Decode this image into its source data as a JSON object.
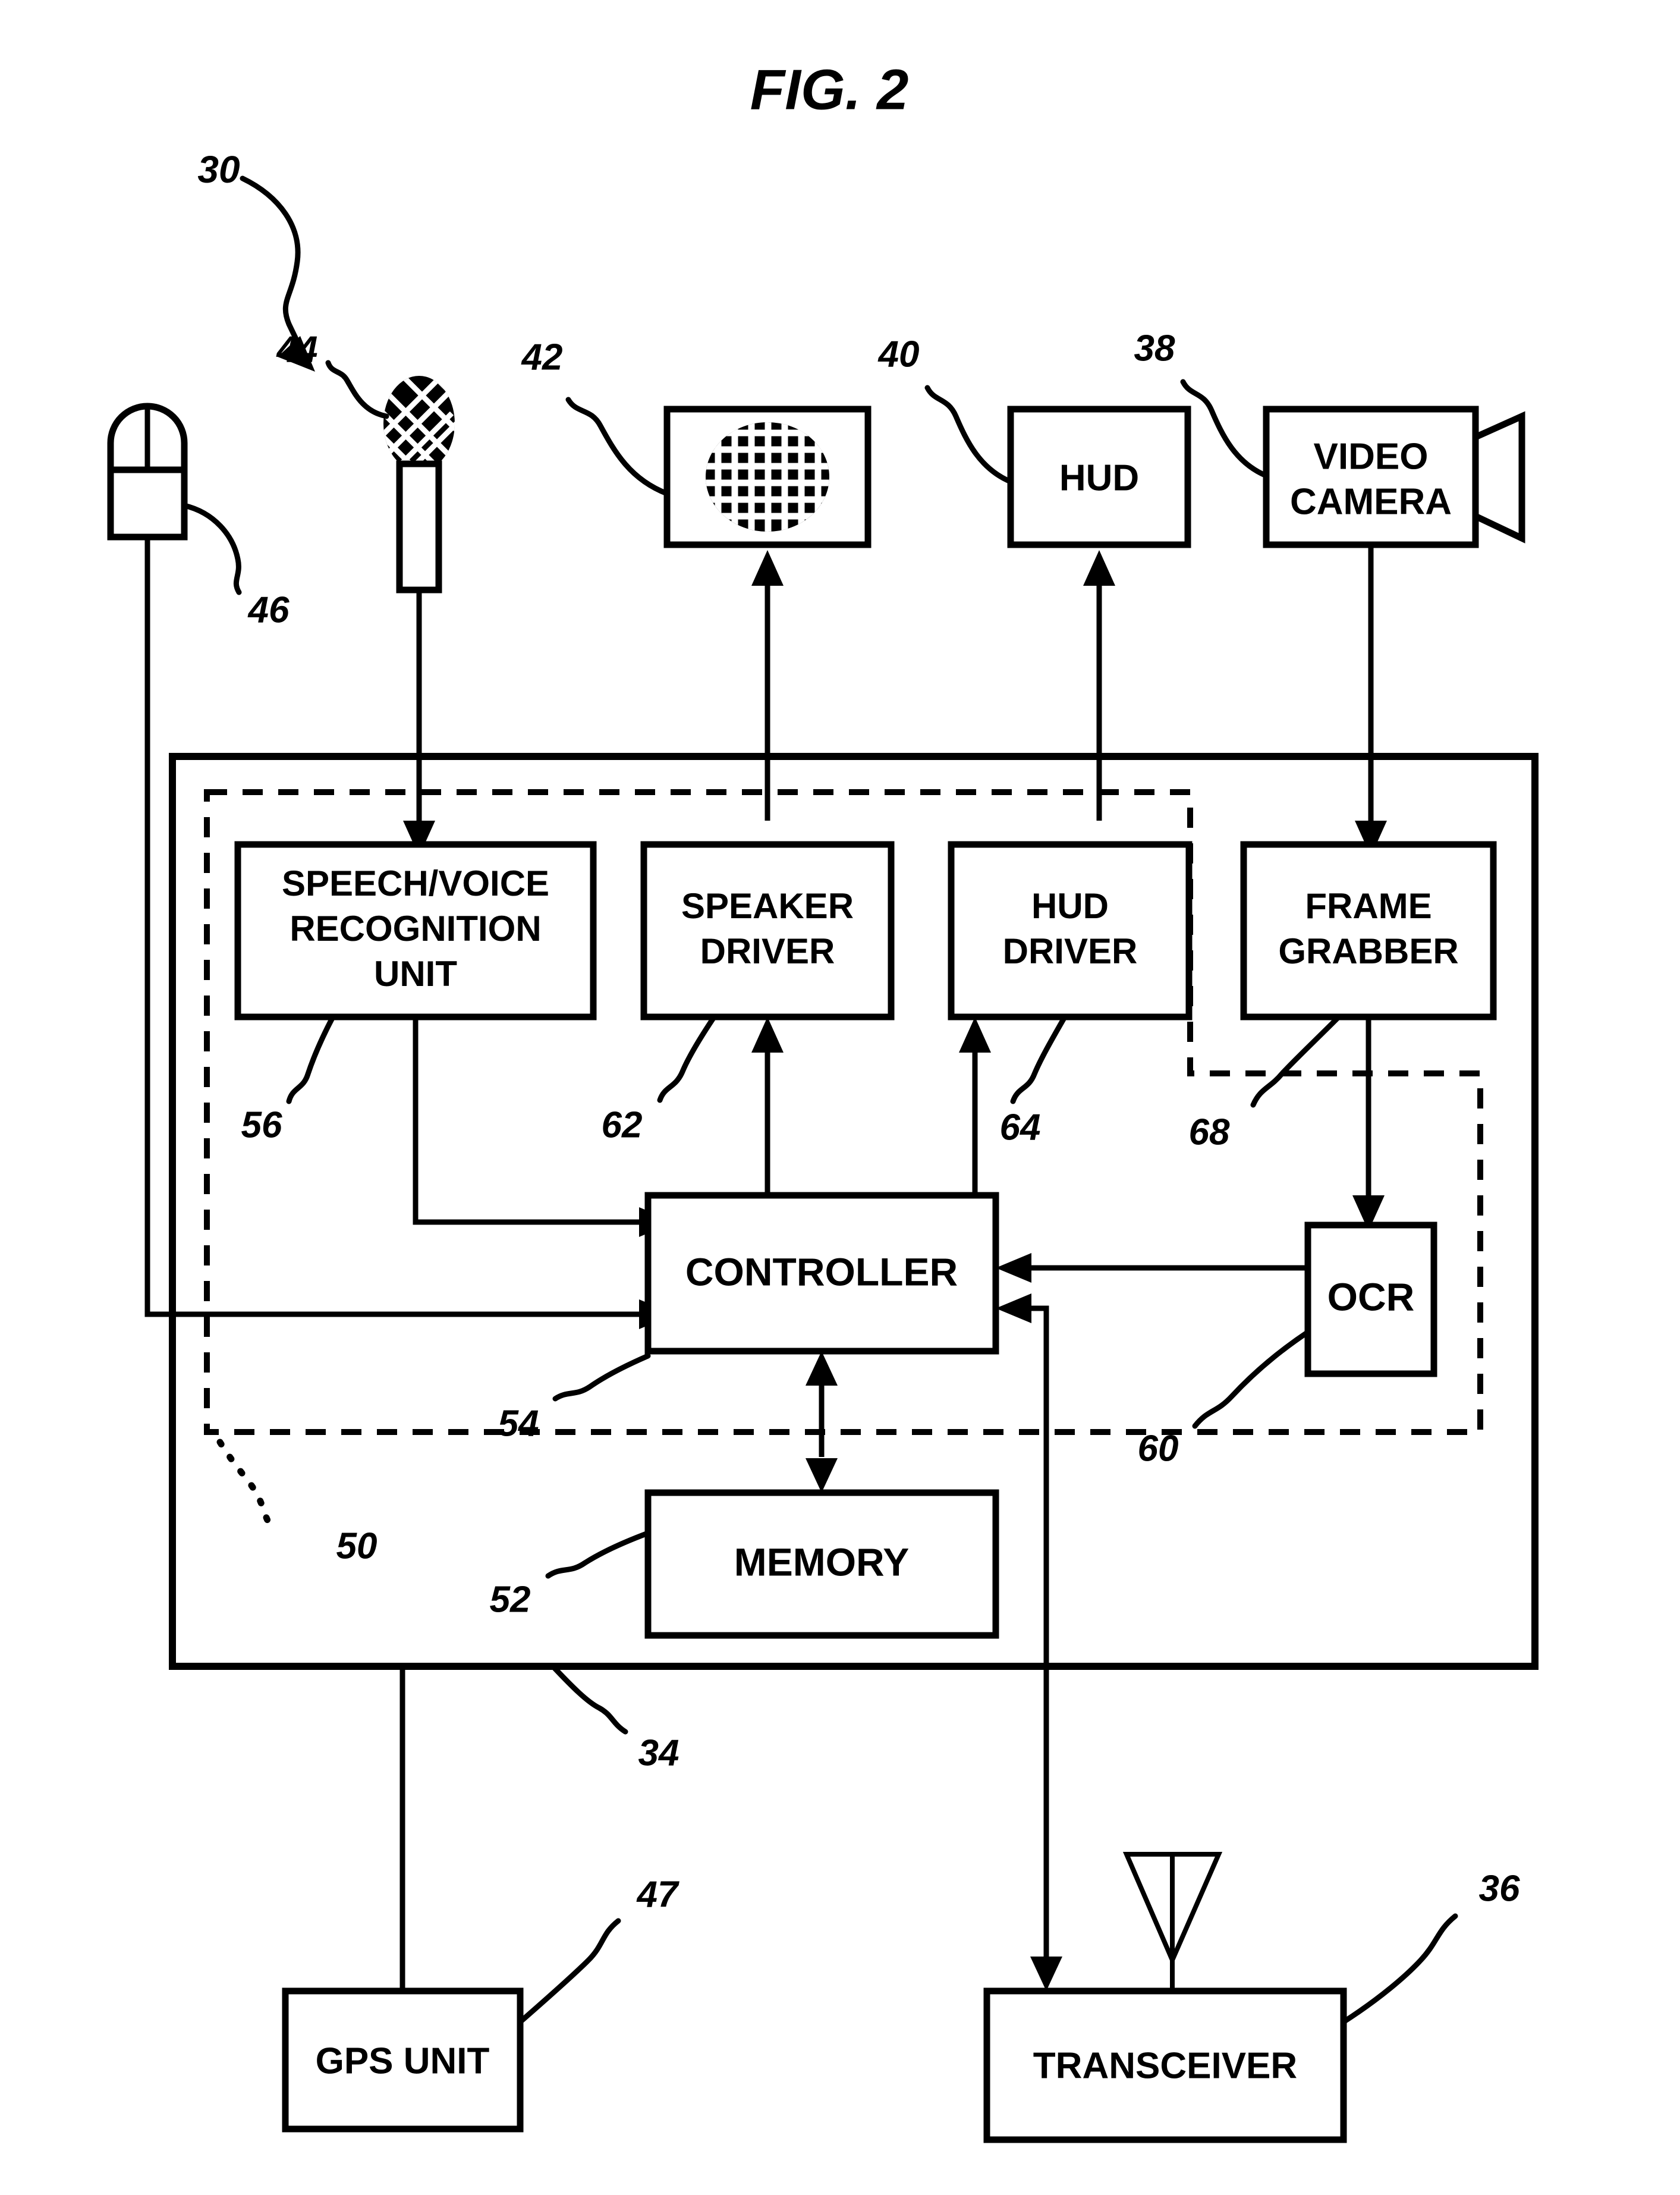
{
  "figure": {
    "title": "FIG. 2",
    "system_ref": "30"
  },
  "devices": [
    {
      "id": "mouse",
      "label": "",
      "ref": "46",
      "icon": "mouse-icon"
    },
    {
      "id": "microphone",
      "label": "",
      "ref": "44",
      "icon": "microphone-icon"
    },
    {
      "id": "speaker",
      "label": "",
      "ref": "42",
      "icon": "speaker-icon"
    },
    {
      "id": "hud",
      "label": "HUD",
      "ref": "40",
      "icon": ""
    },
    {
      "id": "video-camera",
      "label": "VIDEO\nCAMERA",
      "ref": "38",
      "icon": "camera-lens-icon"
    }
  ],
  "blocks": [
    {
      "id": "speech-voice-recognition-unit",
      "lines": [
        "SPEECH/VOICE",
        "RECOGNITION",
        "UNIT"
      ],
      "ref": "56"
    },
    {
      "id": "speaker-driver",
      "lines": [
        "SPEAKER",
        "DRIVER"
      ],
      "ref": "62"
    },
    {
      "id": "hud-driver",
      "lines": [
        "HUD",
        "DRIVER"
      ],
      "ref": "64"
    },
    {
      "id": "frame-grabber",
      "lines": [
        "FRAME",
        "GRABBER"
      ],
      "ref": "68"
    },
    {
      "id": "controller",
      "lines": [
        "CONTROLLER"
      ],
      "ref": "54"
    },
    {
      "id": "ocr",
      "lines": [
        "OCR"
      ],
      "ref": "60"
    },
    {
      "id": "memory",
      "lines": [
        "MEMORY"
      ],
      "ref": "52"
    },
    {
      "id": "gps-unit",
      "lines": [
        "GPS UNIT"
      ],
      "ref": "47"
    },
    {
      "id": "transceiver",
      "lines": [
        "TRANSCEIVER"
      ],
      "ref": "36"
    }
  ],
  "enclosures": [
    {
      "id": "computer-housing",
      "style": "solid",
      "ref": "34"
    },
    {
      "id": "processing-unit",
      "style": "dashed",
      "ref": "50"
    }
  ],
  "text": {
    "speech_l1": "SPEECH/VOICE",
    "speech_l2": "RECOGNITION",
    "speech_l3": "UNIT",
    "speaker_l1": "SPEAKER",
    "speaker_l2": "DRIVER",
    "huddrv_l1": "HUD",
    "huddrv_l2": "DRIVER",
    "frame_l1": "FRAME",
    "frame_l2": "GRABBER",
    "controller": "CONTROLLER",
    "ocr": "OCR",
    "memory": "MEMORY",
    "gps": "GPS UNIT",
    "transceiver": "TRANSCEIVER",
    "hud": "HUD",
    "camera_l1": "VIDEO",
    "camera_l2": "CAMERA"
  },
  "refs": {
    "r30": "30",
    "r34": "34",
    "r36": "36",
    "r38": "38",
    "r40": "40",
    "r42": "42",
    "r44": "44",
    "r46": "46",
    "r47": "47",
    "r50": "50",
    "r52": "52",
    "r54": "54",
    "r56": "56",
    "r60": "60",
    "r62": "62",
    "r64": "64",
    "r68": "68"
  },
  "colors": {
    "ink": "#000000",
    "paper": "#ffffff"
  }
}
